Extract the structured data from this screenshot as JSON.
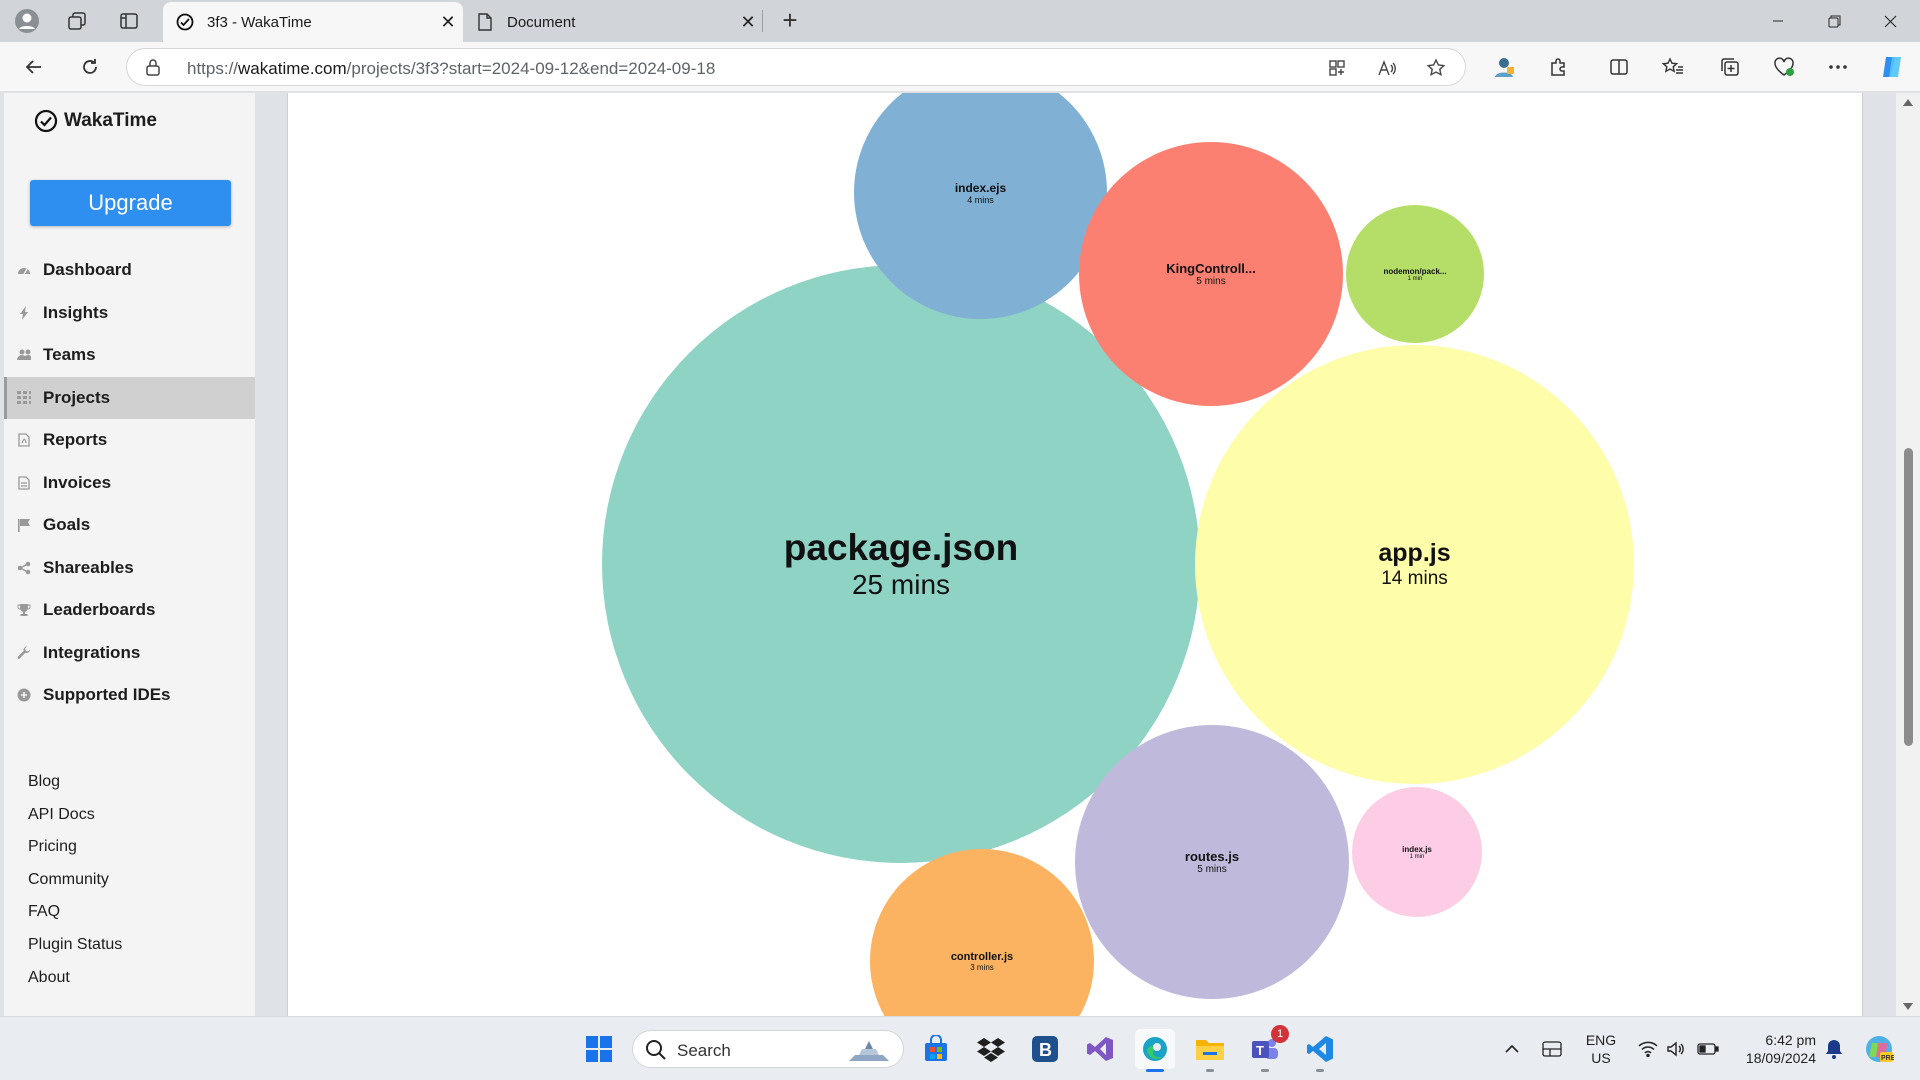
{
  "browser": {
    "tabs": [
      {
        "title": "3f3 - WakaTime",
        "active": true
      },
      {
        "title": "Document",
        "active": false
      }
    ],
    "url_prefix": "https://",
    "url_host": "wakatime.com",
    "url_path": "/projects/3f3?start=2024-09-12&end=2024-09-18"
  },
  "sidebar": {
    "brand": "WakaTime",
    "upgrade_label": "Upgrade",
    "nav": [
      {
        "label": "Dashboard",
        "icon": "dashboard-icon"
      },
      {
        "label": "Insights",
        "icon": "bolt-icon"
      },
      {
        "label": "Teams",
        "icon": "users-icon"
      },
      {
        "label": "Projects",
        "icon": "grid-icon",
        "active": true
      },
      {
        "label": "Reports",
        "icon": "pdf-icon"
      },
      {
        "label": "Invoices",
        "icon": "file-icon"
      },
      {
        "label": "Goals",
        "icon": "flag-icon"
      },
      {
        "label": "Shareables",
        "icon": "share-icon"
      },
      {
        "label": "Leaderboards",
        "icon": "trophy-icon"
      },
      {
        "label": "Integrations",
        "icon": "wrench-icon"
      },
      {
        "label": "Supported IDEs",
        "icon": "plus-circle-icon"
      }
    ],
    "footer": [
      "Blog",
      "API Docs",
      "Pricing",
      "Community",
      "FAQ",
      "Plugin Status",
      "About"
    ]
  },
  "files": [
    {
      "name": "package.json",
      "duration": "25 mins",
      "color": "#8fd3c5"
    },
    {
      "name": "app.js",
      "duration": "14 mins",
      "color": "#fdfdaa"
    },
    {
      "name": "index.ejs",
      "duration": "4 mins",
      "color": "#80b0d4"
    },
    {
      "name": "KingControll...",
      "duration": "5 mins",
      "color": "#fc8071"
    },
    {
      "name": "nodemon/pack...",
      "duration": "1 min",
      "color": "#b4de68"
    },
    {
      "name": "routes.js",
      "duration": "5 mins",
      "color": "#bfbadb"
    },
    {
      "name": "index.js",
      "duration": "1 min",
      "color": "#fccde5"
    },
    {
      "name": "controller.js",
      "duration": "3 mins",
      "color": "#fcb361"
    }
  ],
  "taskbar": {
    "search_placeholder": "Search",
    "lang_line1": "ENG",
    "lang_line2": "US",
    "time": "6:42 pm",
    "date": "18/09/2024",
    "teams_badge": "1"
  }
}
